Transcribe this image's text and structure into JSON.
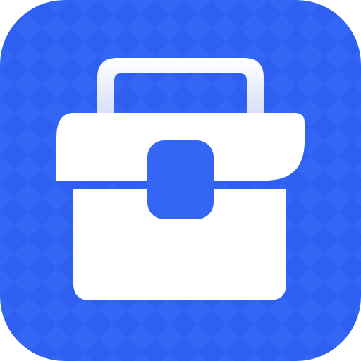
{
  "icon": {
    "name": "toolbox-app-icon",
    "glyph": "toolbox-icon"
  },
  "colors": {
    "background": "#3366F5",
    "background_pattern": "#2F5FF0",
    "glyph": "#FFFFFF",
    "handle_gradient_top": "#FFFFFF",
    "handle_gradient_bottom": "#D3DDF7",
    "latch": "#3366F5"
  }
}
